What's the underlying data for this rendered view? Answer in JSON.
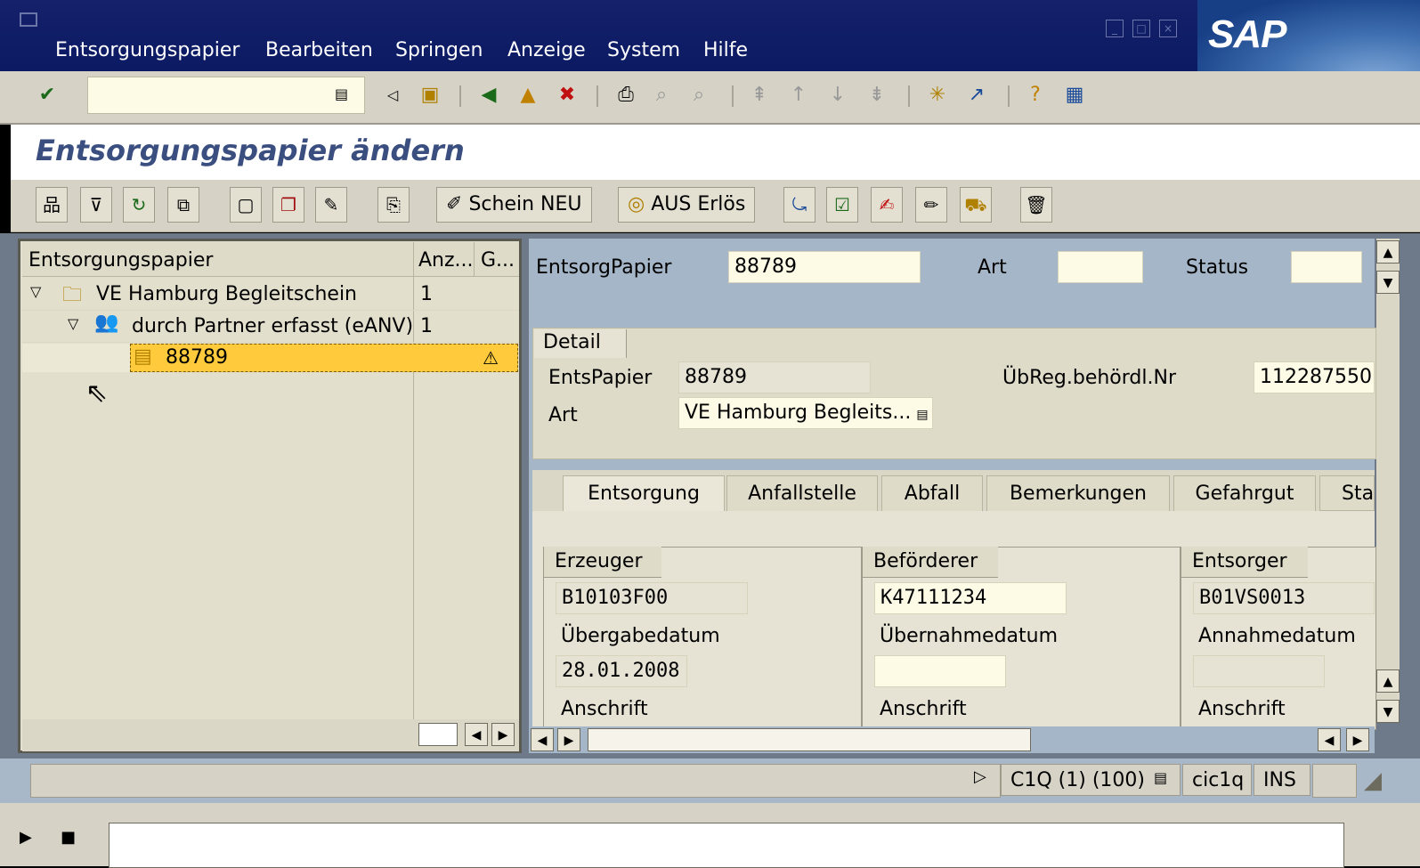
{
  "menu": [
    "Entsorgungspapier",
    "Bearbeiten",
    "Springen",
    "Anzeige",
    "System",
    "Hilfe"
  ],
  "logo": "SAP",
  "page_title": "Entsorgungspapier ändern",
  "app_toolbar": {
    "schein_neu": "Schein NEU",
    "aus_erloes": "AUS Erlös"
  },
  "tree": {
    "header": {
      "col1": "Entsorgungspapier",
      "col2": "Anz...",
      "col3": "G..."
    },
    "rows": [
      {
        "label": "VE Hamburg Begleitschein",
        "count": "1"
      },
      {
        "label": "durch Partner erfasst (eANV)",
        "count": "1"
      },
      {
        "label": "88789",
        "count": ""
      }
    ]
  },
  "header_fields": {
    "entsorgpapier_label": "EntsorgPapier",
    "entsorgpapier_value": "88789",
    "art_label": "Art",
    "art_value": "",
    "status_label": "Status",
    "status_value": ""
  },
  "detail": {
    "title": "Detail",
    "entspapier_label": "EntsPapier",
    "entspapier_value": "88789",
    "art_label": "Art",
    "art_value": "VE Hamburg Begleits...",
    "uebreg_label": "ÜbReg.behördl.Nr",
    "uebreg_value": "112287550"
  },
  "tabs": [
    "Entsorgung",
    "Anfallstelle",
    "Abfall",
    "Bemerkungen",
    "Gefahrgut",
    "Sta"
  ],
  "entsorgung": {
    "erzeuger": {
      "title": "Erzeuger",
      "id": "B10103F00",
      "date_label": "Übergabedatum",
      "date_value": "28.01.2008",
      "address_label": "Anschrift"
    },
    "befoerderer": {
      "title": "Beförderer",
      "id": "K47111234",
      "date_label": "Übernahmedatum",
      "date_value": "",
      "address_label": "Anschrift"
    },
    "entsorger": {
      "title": "Entsorger",
      "id": "B01VS0013",
      "date_label": "Annahmedatum",
      "date_value": "",
      "address_label": "Anschrift"
    }
  },
  "status": {
    "system": "C1Q (1) (100)",
    "server": "cic1q",
    "mode": "INS"
  }
}
